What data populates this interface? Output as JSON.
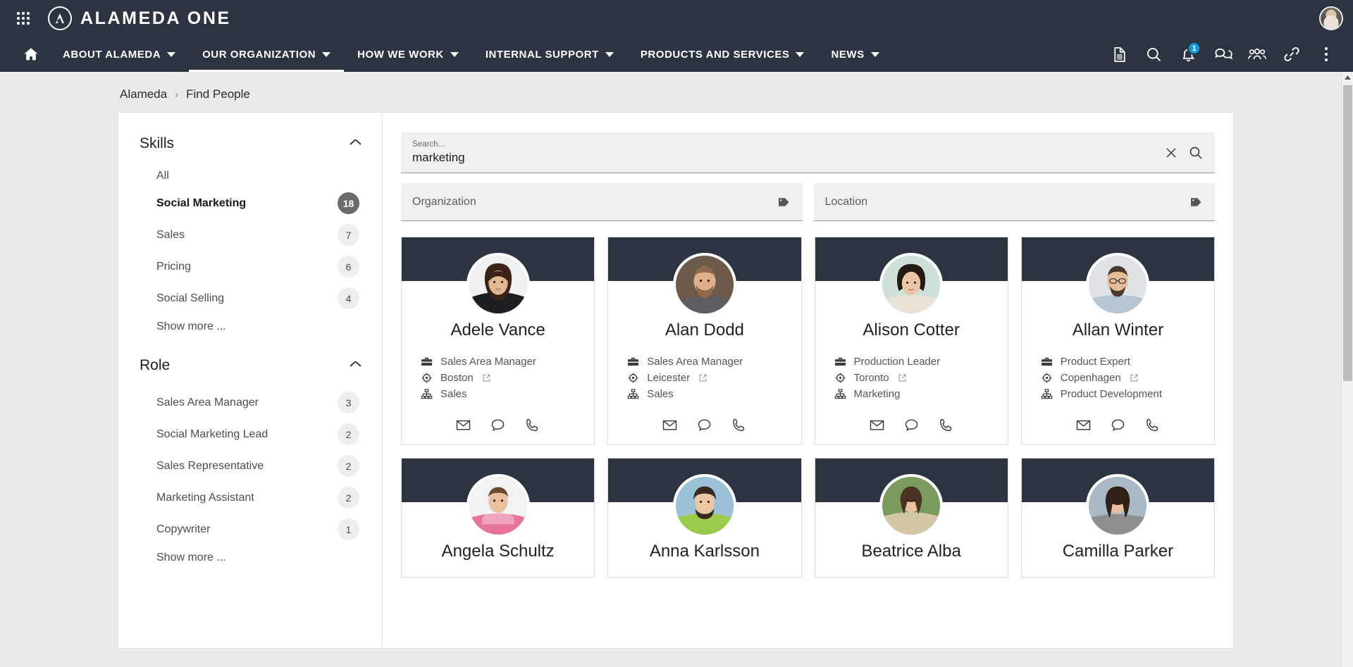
{
  "brand": {
    "waffle_icon": "apps-grid-icon",
    "logo_icon": "alameda-logo-icon",
    "title": "ALAMEDA ONE",
    "avatar_icon": "user-avatar"
  },
  "mainnav": {
    "home_icon": "home-icon",
    "items": [
      {
        "label": "ABOUT ALAMEDA",
        "active": false
      },
      {
        "label": "OUR ORGANIZATION",
        "active": true
      },
      {
        "label": "HOW WE WORK",
        "active": false
      },
      {
        "label": "INTERNAL SUPPORT",
        "active": false
      },
      {
        "label": "PRODUCTS AND SERVICES",
        "active": false
      },
      {
        "label": "NEWS",
        "active": false
      }
    ],
    "right_icons": [
      {
        "name": "document-icon"
      },
      {
        "name": "search-icon"
      },
      {
        "name": "bell-icon",
        "badge": "1"
      },
      {
        "name": "chat-icon"
      },
      {
        "name": "people-icon"
      },
      {
        "name": "link-icon"
      },
      {
        "name": "kebab-menu-icon"
      }
    ],
    "badge_color": "#0f9bd9"
  },
  "breadcrumb": {
    "root": "Alameda",
    "separator": "›",
    "current": "Find People"
  },
  "sidebar": {
    "facets": [
      {
        "title": "Skills",
        "collapse_icon": "chevron-up-icon",
        "items": [
          {
            "label": "All",
            "count": "",
            "selected": false
          },
          {
            "label": "Social Marketing",
            "count": "18",
            "selected": true
          },
          {
            "label": "Sales",
            "count": "7",
            "selected": false
          },
          {
            "label": "Pricing",
            "count": "6",
            "selected": false
          },
          {
            "label": "Social Selling",
            "count": "4",
            "selected": false
          }
        ],
        "show_more": "Show more ..."
      },
      {
        "title": "Role",
        "collapse_icon": "chevron-up-icon",
        "items": [
          {
            "label": "Sales Area Manager",
            "count": "3",
            "selected": false
          },
          {
            "label": "Social Marketing Lead",
            "count": "2",
            "selected": false
          },
          {
            "label": "Sales Representative",
            "count": "2",
            "selected": false
          },
          {
            "label": "Marketing Assistant",
            "count": "2",
            "selected": false
          },
          {
            "label": "Copywriter",
            "count": "1",
            "selected": false
          }
        ],
        "show_more": "Show more ..."
      }
    ]
  },
  "search": {
    "label": "Search...",
    "value": "marketing",
    "clear_icon": "close-icon",
    "submit_icon": "search-icon"
  },
  "filters": [
    {
      "label": "Organization",
      "icon": "tag-icon"
    },
    {
      "label": "Location",
      "icon": "tag-icon"
    }
  ],
  "cards": [
    {
      "name": "Adele Vance",
      "role": "Sales Area Manager",
      "location": "Boston",
      "org": "Sales",
      "avatar": {
        "skin": "#e3b894",
        "hair": "#3b2217",
        "bg": "#eef0f2",
        "top": "#1d1d22"
      },
      "actions": [
        "mail-icon",
        "chat-icon",
        "phone-icon"
      ]
    },
    {
      "name": "Alan Dodd",
      "role": "Sales Area Manager",
      "location": "Leicester",
      "org": "Sales",
      "avatar": {
        "skin": "#e0b08c",
        "hair": "#8c6a4a",
        "bg": "#6d5a48",
        "top": "#5d5d62"
      },
      "actions": [
        "mail-icon",
        "chat-icon",
        "phone-icon"
      ]
    },
    {
      "name": "Alison Cotter",
      "role": "Production Leader",
      "location": "Toronto",
      "org": "Marketing",
      "avatar": {
        "skin": "#eac6a6",
        "hair": "#241a13",
        "bg": "#cfe0d9",
        "top": "#e9e2d6"
      },
      "actions": [
        "mail-icon",
        "chat-icon",
        "phone-icon"
      ]
    },
    {
      "name": "Allan Winter",
      "role": "Product Expert",
      "location": "Copenhagen",
      "org": "Product Development",
      "avatar": {
        "skin": "#e6bb96",
        "hair": "#4a392c",
        "bg": "#dfe3e6",
        "top": "#b8c6d4"
      },
      "actions": [
        "mail-icon",
        "chat-icon",
        "phone-icon"
      ]
    },
    {
      "name": "Angela Schultz",
      "role": "",
      "location": "",
      "org": "",
      "avatar": {
        "skin": "#eac2a0",
        "hair": "#6b4a33",
        "bg": "#f2f2f2",
        "top": "#e8739d"
      },
      "actions": [
        "mail-icon",
        "chat-icon",
        "phone-icon"
      ]
    },
    {
      "name": "Anna Karlsson",
      "role": "",
      "location": "",
      "org": "",
      "avatar": {
        "skin": "#edc6a4",
        "hair": "#3a2a1e",
        "bg": "#9cc2d8",
        "top": "#9ccb4a"
      },
      "actions": [
        "mail-icon",
        "chat-icon",
        "phone-icon"
      ]
    },
    {
      "name": "Beatrice Alba",
      "role": "",
      "location": "",
      "org": "",
      "avatar": {
        "skin": "#e9c3a1",
        "hair": "#4b3323",
        "bg": "#7b9a5e",
        "top": "#d5c6a8"
      },
      "actions": [
        "mail-icon",
        "chat-icon",
        "phone-icon"
      ]
    },
    {
      "name": "Camilla Parker",
      "role": "",
      "location": "",
      "org": "",
      "avatar": {
        "skin": "#e7c0a0",
        "hair": "#2f2018",
        "bg": "#aab9c6",
        "top": "#8d8f90"
      },
      "actions": [
        "mail-icon",
        "chat-icon",
        "phone-icon"
      ]
    }
  ],
  "scrollbar": {
    "up_icon": "scroll-up-arrow"
  },
  "colors": {
    "navy": "#2b3440",
    "page_bg": "#eaeaea",
    "accent": "#0f9bd9"
  }
}
